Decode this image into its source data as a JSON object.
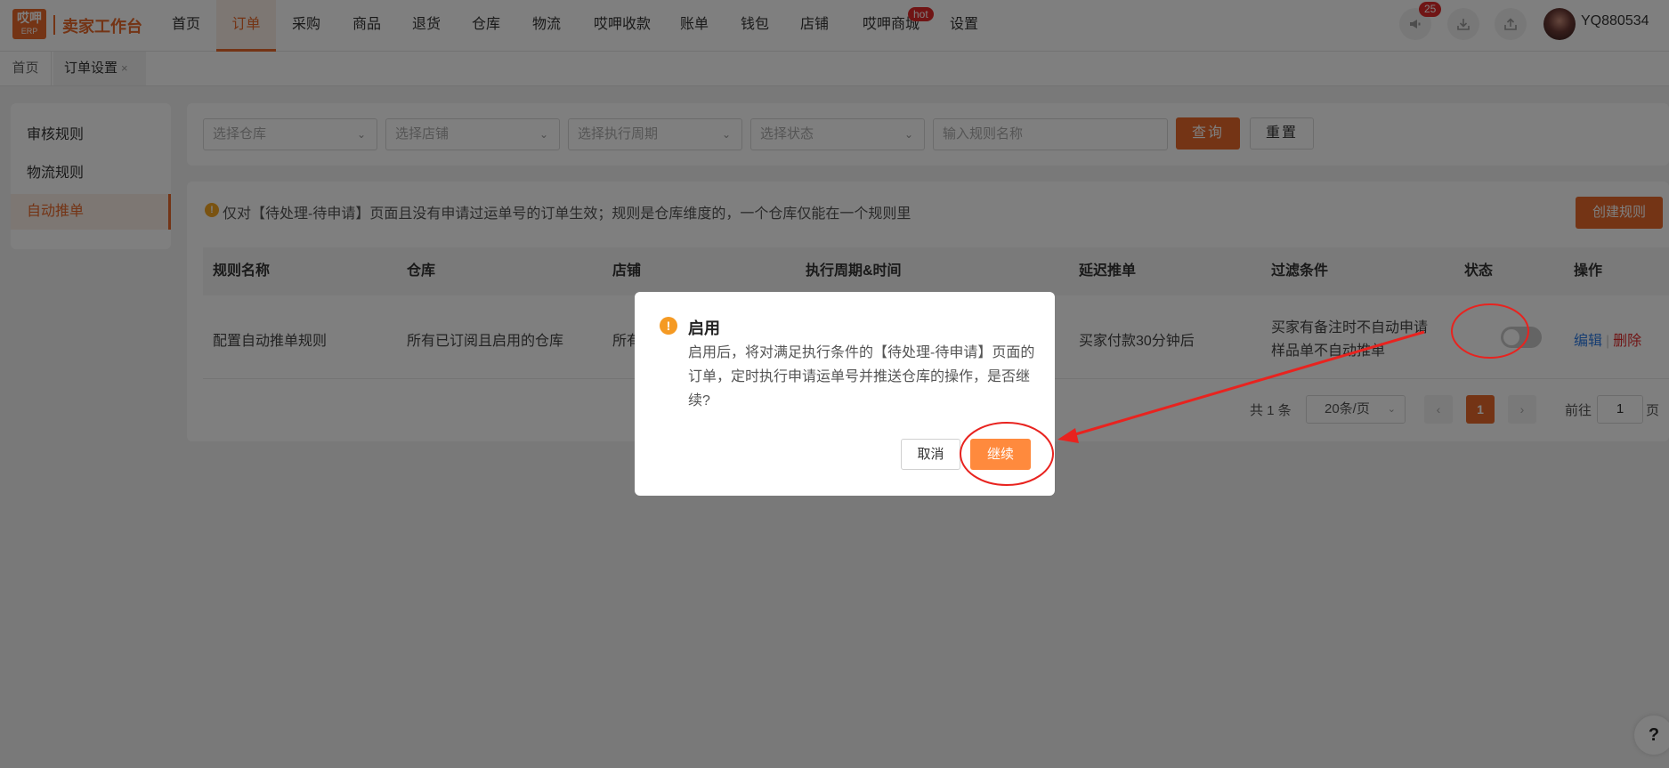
{
  "topnav": {
    "logo_line1": "哎呷",
    "logo_line2": "ERP",
    "brand": "卖家工作台",
    "items": [
      {
        "label": "首页"
      },
      {
        "label": "订单"
      },
      {
        "label": "采购"
      },
      {
        "label": "商品"
      },
      {
        "label": "退货"
      },
      {
        "label": "仓库"
      },
      {
        "label": "物流"
      },
      {
        "label": "哎呷收款"
      },
      {
        "label": "账单"
      },
      {
        "label": "钱包"
      },
      {
        "label": "店铺"
      },
      {
        "label": "哎呷商城"
      },
      {
        "label": "设置"
      }
    ],
    "active_index": 1,
    "hot_badge": "hot",
    "notify_count": "25",
    "username": "YQ880534"
  },
  "tabs": [
    {
      "label": "首页"
    },
    {
      "label": "订单设置",
      "close": "×"
    }
  ],
  "sidebar": {
    "items": [
      {
        "label": "审核规则"
      },
      {
        "label": "物流规则"
      },
      {
        "label": "自动推单"
      }
    ],
    "active_index": 2
  },
  "filters": {
    "warehouse_placeholder": "选择仓库",
    "store_placeholder": "选择店铺",
    "period_placeholder": "选择执行周期",
    "status_placeholder": "选择状态",
    "rule_name_placeholder": "输入规则名称",
    "query_label": "查询",
    "reset_label": "重置"
  },
  "main": {
    "notice": "仅对【待处理-待申请】页面且没有申请过运单号的订单生效；规则是仓库维度的，一个仓库仅能在一个规则里",
    "create_label": "创建规则",
    "columns": [
      "规则名称",
      "仓库",
      "店铺",
      "执行周期&时间",
      "延迟推单",
      "过滤条件",
      "状态",
      "操作"
    ],
    "rows": [
      {
        "name": "配置自动推单规则",
        "warehouse": "所有已订阅且启用的仓库",
        "store": "所有",
        "delay": "买家付款30分钟后",
        "filter_line1": "买家有备注时不自动申请",
        "filter_line2": "样品单不自动推单",
        "enabled": false,
        "edit_label": "编辑",
        "delete_label": "删除"
      }
    ]
  },
  "pagination": {
    "total_text": "共 1 条",
    "page_size": "20条/页",
    "current_page": "1",
    "goto_label": "前往",
    "goto_value": "1",
    "page_suffix": "页"
  },
  "modal": {
    "title": "启用",
    "body": "启用后，将对满足执行条件的【待处理-待申请】页面的订单，定时执行申请运单号并推送仓库的操作，是否继续?",
    "cancel_label": "取消",
    "continue_label": "继续"
  },
  "help_label": "?",
  "colors": {
    "accent": "#e8682a",
    "continue_button": "#ff8a3d",
    "annotation": "#e8231f"
  }
}
